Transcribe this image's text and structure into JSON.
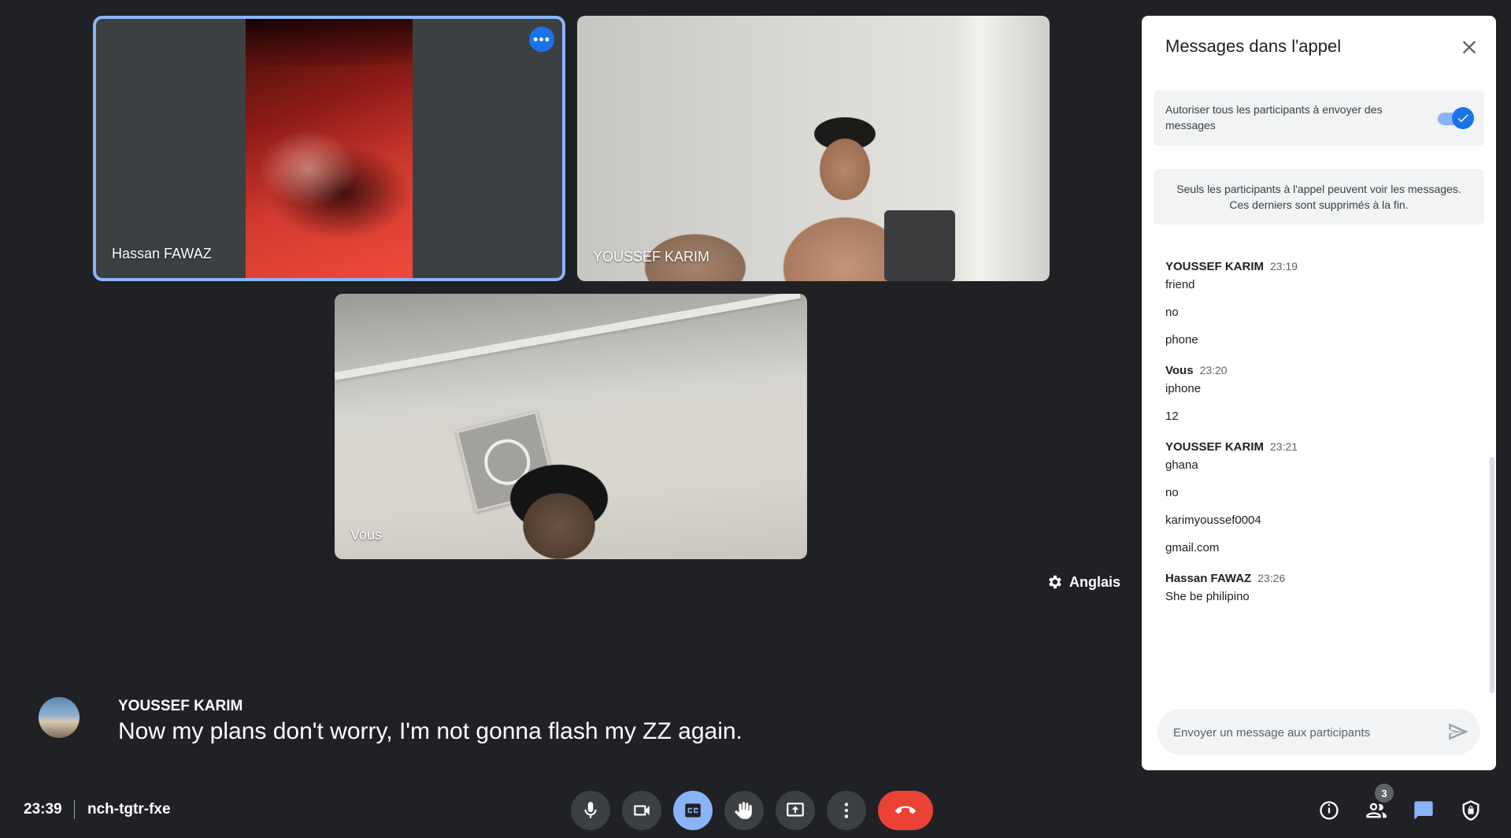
{
  "tiles": {
    "hassan": {
      "name": "Hassan FAWAZ"
    },
    "youssef": {
      "name": "YOUSSEF KARIM"
    },
    "vous": {
      "name": "Vous"
    }
  },
  "caption": {
    "speaker": "YOUSSEF KARIM",
    "text": "Now my plans don't worry, I'm not gonna flash my ZZ again."
  },
  "language": {
    "label": "Anglais"
  },
  "meeting": {
    "time": "23:39",
    "code": "nch-tgtr-fxe"
  },
  "controls": {
    "people_count": "3",
    "colors": {
      "end_call": "#ea4335",
      "active": "#8ab4f8",
      "accent": "#1a73e8"
    }
  },
  "chat": {
    "title": "Messages dans l'appel",
    "allow_text": "Autoriser tous les participants à envoyer des messages",
    "info_text": "Seuls les participants à l'appel peuvent voir les messages. Ces derniers sont supprimés à la fin.",
    "input_placeholder": "Envoyer un message aux participants",
    "groups": [
      {
        "sender": "YOUSSEF KARIM",
        "time": "23:19",
        "lines": [
          "friend",
          "no",
          "phone"
        ]
      },
      {
        "sender": "Vous",
        "time": "23:20",
        "lines": [
          "iphone",
          "12"
        ]
      },
      {
        "sender": "YOUSSEF KARIM",
        "time": "23:21",
        "lines": [
          "ghana",
          "no",
          "karimyoussef0004",
          "gmail.com"
        ]
      },
      {
        "sender": "Hassan FAWAZ",
        "time": "23:26",
        "lines": [
          "She be philipino"
        ]
      }
    ]
  }
}
